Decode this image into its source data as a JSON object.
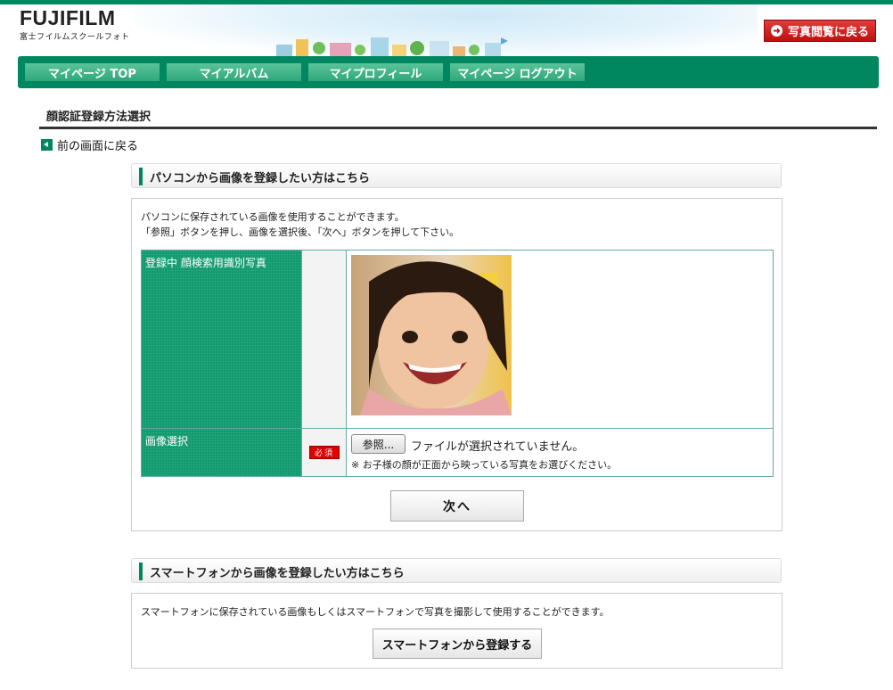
{
  "header": {
    "logo_main": "FUJIFILM",
    "logo_sub": "富士フイルムスクールフォト",
    "back_to_album": "写真閲覧に戻る"
  },
  "nav": {
    "items": [
      {
        "label": "マイページ TOP"
      },
      {
        "label": "マイアルバム"
      },
      {
        "label": "マイプロフィール"
      },
      {
        "label": "マイページ ログアウト"
      }
    ]
  },
  "page": {
    "title": "顔認証登録方法選択",
    "prev_link": "前の画面に戻る"
  },
  "pc_section": {
    "heading": "パソコンから画像を登録したい方はこちら",
    "desc_line1": "パソコンに保存されている画像を使用することができます。",
    "desc_line2": "「参照」ボタンを押し、画像を選択後、「次へ」ボタンを押して下さい。",
    "registered_label": "登録中 顔検索用識別写真",
    "image_select_label": "画像選択",
    "required_badge": "必須",
    "browse_button": "参照...",
    "file_status": "ファイルが選択されていません。",
    "photo_note": "※ お子様の顔が正面から映っている写真をお選びください。",
    "next_button": "次へ"
  },
  "sp_section": {
    "heading": "スマートフォンから画像を登録したい方はこちら",
    "desc": "スマートフォンに保存されている画像もしくはスマートフォンで写真を撮影して使用することができます。",
    "register_button": "スマートフォンから登録する"
  },
  "colors": {
    "brand_green": "#00875f",
    "nav_button": "#3bb386",
    "table_green": "#0f9a6e",
    "required_red": "#e00000",
    "back_button_red": "#d02020"
  },
  "icons": {
    "back_album_arrow": "arrow-right-icon",
    "prev_arrow": "triangle-left-icon"
  }
}
